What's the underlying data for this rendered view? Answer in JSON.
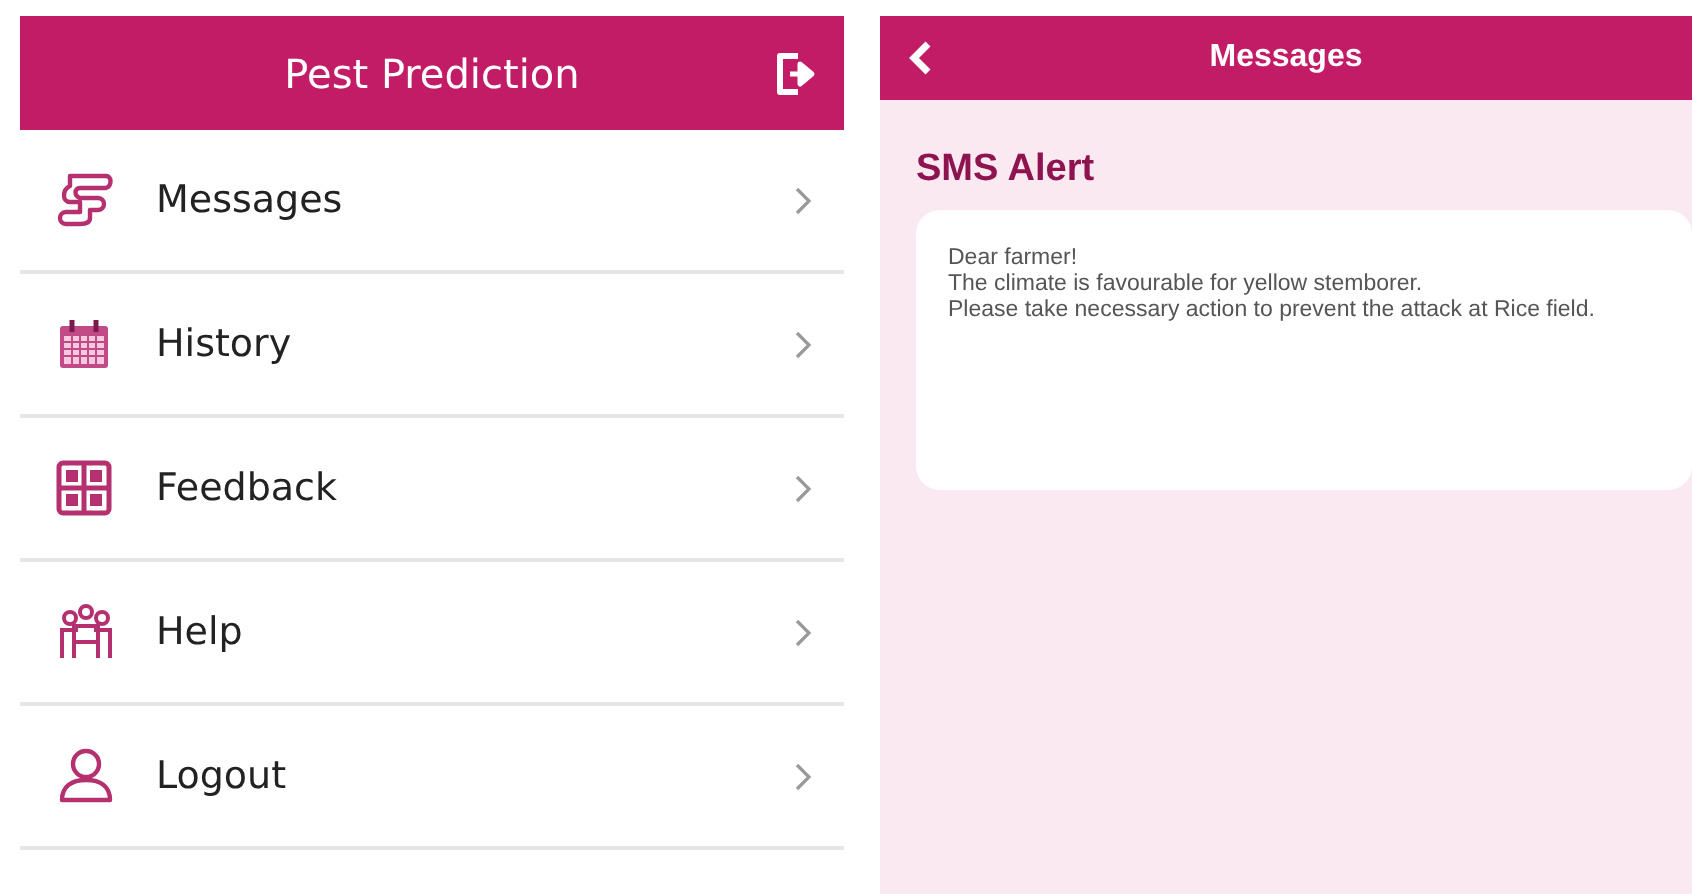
{
  "menu_screen": {
    "title": "Pest Prediction",
    "items": [
      {
        "label": "Messages"
      },
      {
        "label": "History"
      },
      {
        "label": "Feedback"
      },
      {
        "label": "Help"
      },
      {
        "label": "Logout"
      }
    ]
  },
  "messages_screen": {
    "title": "Messages",
    "heading": "SMS Alert",
    "message_lines": [
      "Dear farmer!",
      "The climate is favourable for yellow stemborer.",
      "Please take necessary action to prevent the attack at Rice field."
    ]
  }
}
